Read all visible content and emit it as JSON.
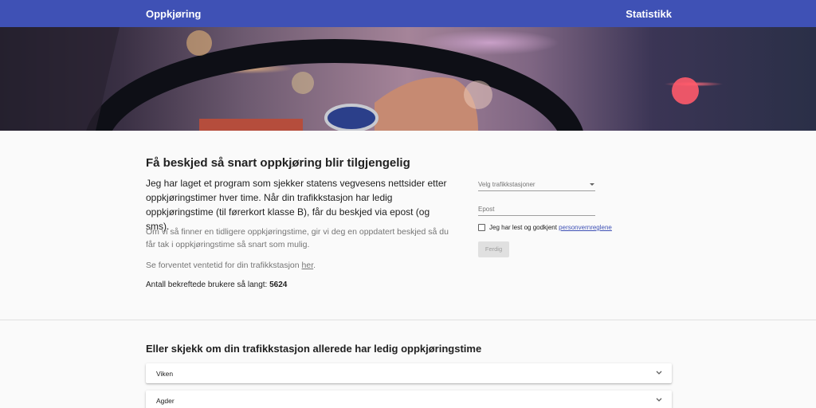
{
  "header": {
    "brand": "Oppkjøring",
    "stats_link": "Statistikk"
  },
  "intro": {
    "title": "Få beskjed så snart oppkjøring blir tilgjengelig",
    "lead": "Jeg har laget et program som sjekker statens vegvesens nettsider etter oppkjøringstimer hver time. Når din trafikkstasjon har ledig oppkjøringstime (til førerkort klasse B), får du beskjed via epost (og sms).",
    "paragraph": "Om vi så finner en tidligere oppkjøringstime, gir vi deg en oppdatert beskjed så du får tak i oppkjøringstime så snart som mulig.",
    "wait_text": "Se forventet ventetid for din trafikkstasjon ",
    "wait_link": "her",
    "wait_suffix": ".",
    "count_label": "Antall bekreftede brukere så langt: ",
    "count_value": "5624"
  },
  "form": {
    "station_placeholder": "Velg trafikkstasjoner",
    "email_placeholder": "Epost",
    "terms_text": "Jeg har lest og godkjent ",
    "terms_link": "personvernreglene",
    "submit_label": "Ferdig"
  },
  "stations": {
    "title": "Eller skjekk om din trafikkstasjon allerede har ledig oppkjøringstime",
    "regions": [
      {
        "label": "Viken"
      },
      {
        "label": "Agder"
      }
    ]
  }
}
